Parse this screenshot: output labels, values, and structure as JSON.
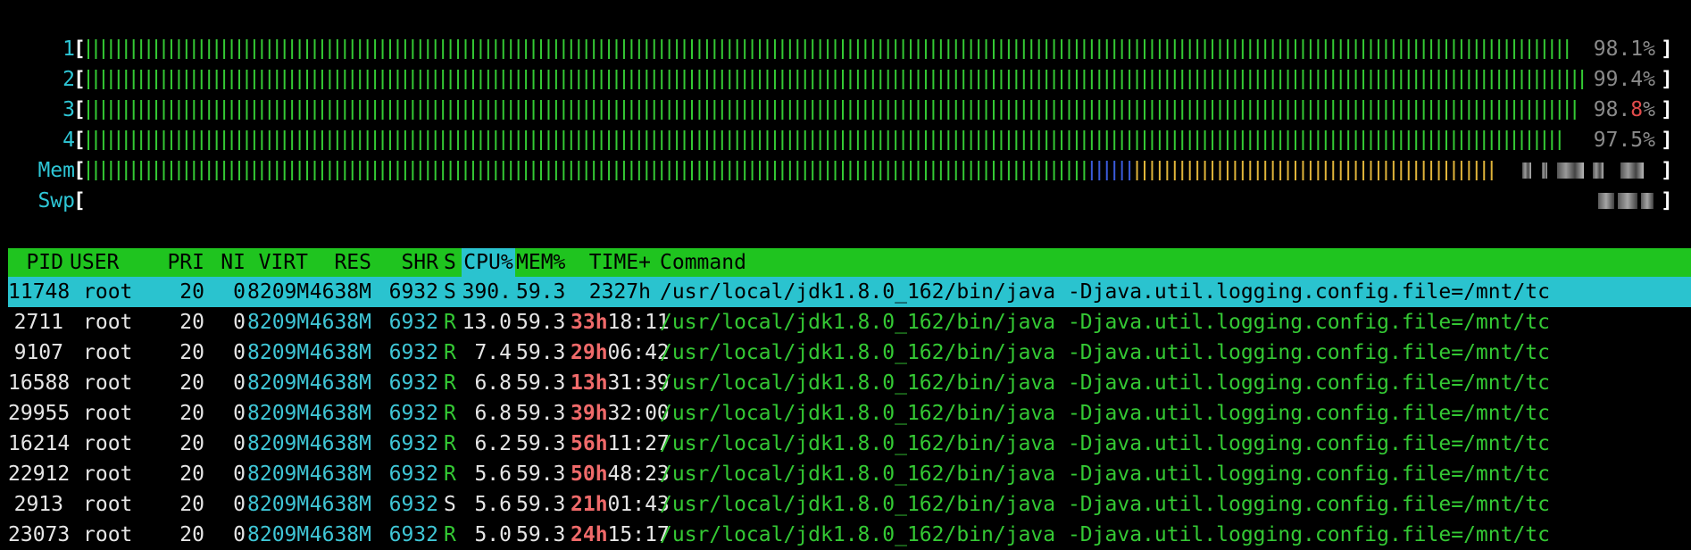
{
  "meters": [
    {
      "label": "1",
      "pct_text": "98.1%",
      "pct_main": "98.1",
      "pct_tail": "%",
      "tail_hot": false,
      "fill": 0.981
    },
    {
      "label": "2",
      "pct_text": "99.4%",
      "pct_main": "99.4",
      "pct_tail": "%",
      "tail_hot": false,
      "fill": 0.994
    },
    {
      "label": "3",
      "pct_text": "98.8%",
      "pct_main": "98.",
      "pct_hot": "8",
      "pct_tail": "%",
      "tail_hot": true,
      "fill": 0.988
    },
    {
      "label": "4",
      "pct_text": "97.5%",
      "pct_main": "97.5",
      "pct_tail": "%",
      "tail_hot": false,
      "fill": 0.975
    }
  ],
  "mem": {
    "label": "Mem",
    "used_fraction": 0.64,
    "buffers_fraction": 0.03,
    "cache_fraction": 0.23
  },
  "swp": {
    "label": "Swp"
  },
  "columns": [
    "PID",
    "USER",
    "PRI",
    "NI",
    "VIRT",
    "RES",
    "SHR",
    "S",
    "CPU%",
    "MEM%",
    "TIME+",
    "Command"
  ],
  "processes": [
    {
      "pid": "11748",
      "user": "root",
      "pri": "20",
      "ni": "0",
      "virt": "8209M",
      "res": "4638M",
      "shr": "6932",
      "s": "S",
      "cpu": "390.",
      "mem": "59.3",
      "time_h": "",
      "time_rest": "2327h",
      "cmd_bin": "/usr/local/jdk1.8.0_162/bin/java",
      "cmd_args": " -Djava.util.logging.config.file=/mnt/tc",
      "selected": true
    },
    {
      "pid": "2711",
      "user": "root",
      "pri": "20",
      "ni": "0",
      "virt": "8209M",
      "res": "4638M",
      "shr": "6932",
      "s": "R",
      "cpu": "13.0",
      "mem": "59.3",
      "time_h": "33h",
      "time_rest": "18:11",
      "cmd_bin": "/usr/local/jdk1.8.0_162/bin/java",
      "cmd_args": " -Djava.util.logging.config.file=/mnt/tc",
      "selected": false
    },
    {
      "pid": "9107",
      "user": "root",
      "pri": "20",
      "ni": "0",
      "virt": "8209M",
      "res": "4638M",
      "shr": "6932",
      "s": "R",
      "cpu": "7.4",
      "mem": "59.3",
      "time_h": "29h",
      "time_rest": "06:42",
      "cmd_bin": "/usr/local/jdk1.8.0_162/bin/java",
      "cmd_args": " -Djava.util.logging.config.file=/mnt/tc",
      "selected": false
    },
    {
      "pid": "16588",
      "user": "root",
      "pri": "20",
      "ni": "0",
      "virt": "8209M",
      "res": "4638M",
      "shr": "6932",
      "s": "R",
      "cpu": "6.8",
      "mem": "59.3",
      "time_h": "13h",
      "time_rest": "31:39",
      "cmd_bin": "/usr/local/jdk1.8.0_162/bin/java",
      "cmd_args": " -Djava.util.logging.config.file=/mnt/tc",
      "selected": false
    },
    {
      "pid": "29955",
      "user": "root",
      "pri": "20",
      "ni": "0",
      "virt": "8209M",
      "res": "4638M",
      "shr": "6932",
      "s": "R",
      "cpu": "6.8",
      "mem": "59.3",
      "time_h": "39h",
      "time_rest": "32:00",
      "cmd_bin": "/usr/local/jdk1.8.0_162/bin/java",
      "cmd_args": " -Djava.util.logging.config.file=/mnt/tc",
      "selected": false
    },
    {
      "pid": "16214",
      "user": "root",
      "pri": "20",
      "ni": "0",
      "virt": "8209M",
      "res": "4638M",
      "shr": "6932",
      "s": "R",
      "cpu": "6.2",
      "mem": "59.3",
      "time_h": "56h",
      "time_rest": "11:27",
      "cmd_bin": "/usr/local/jdk1.8.0_162/bin/java",
      "cmd_args": " -Djava.util.logging.config.file=/mnt/tc",
      "selected": false
    },
    {
      "pid": "22912",
      "user": "root",
      "pri": "20",
      "ni": "0",
      "virt": "8209M",
      "res": "4638M",
      "shr": "6932",
      "s": "R",
      "cpu": "5.6",
      "mem": "59.3",
      "time_h": "50h",
      "time_rest": "48:23",
      "cmd_bin": "/usr/local/jdk1.8.0_162/bin/java",
      "cmd_args": " -Djava.util.logging.config.file=/mnt/tc",
      "selected": false
    },
    {
      "pid": "2913",
      "user": "root",
      "pri": "20",
      "ni": "0",
      "virt": "8209M",
      "res": "4638M",
      "shr": "6932",
      "s": "S",
      "cpu": "5.6",
      "mem": "59.3",
      "time_h": "21h",
      "time_rest": "01:43",
      "cmd_bin": "/usr/local/jdk1.8.0_162/bin/java",
      "cmd_args": " -Djava.util.logging.config.file=/mnt/tc",
      "selected": false
    },
    {
      "pid": "23073",
      "user": "root",
      "pri": "20",
      "ni": "0",
      "virt": "8209M",
      "res": "4638M",
      "shr": "6932",
      "s": "R",
      "cpu": "5.0",
      "mem": "59.3",
      "time_h": "24h",
      "time_rest": "15:17",
      "cmd_bin": "/usr/local/jdk1.8.0_162/bin/java",
      "cmd_args": " -Djava.util.logging.config.file=/mnt/tc",
      "selected": false
    }
  ],
  "colors": {
    "green": "#34c934",
    "blue": "#3b5bdb",
    "yellow": "#e0b43a",
    "cyan": "#2ac3cf",
    "red": "#e14b4b",
    "header": "#1fc41f"
  }
}
